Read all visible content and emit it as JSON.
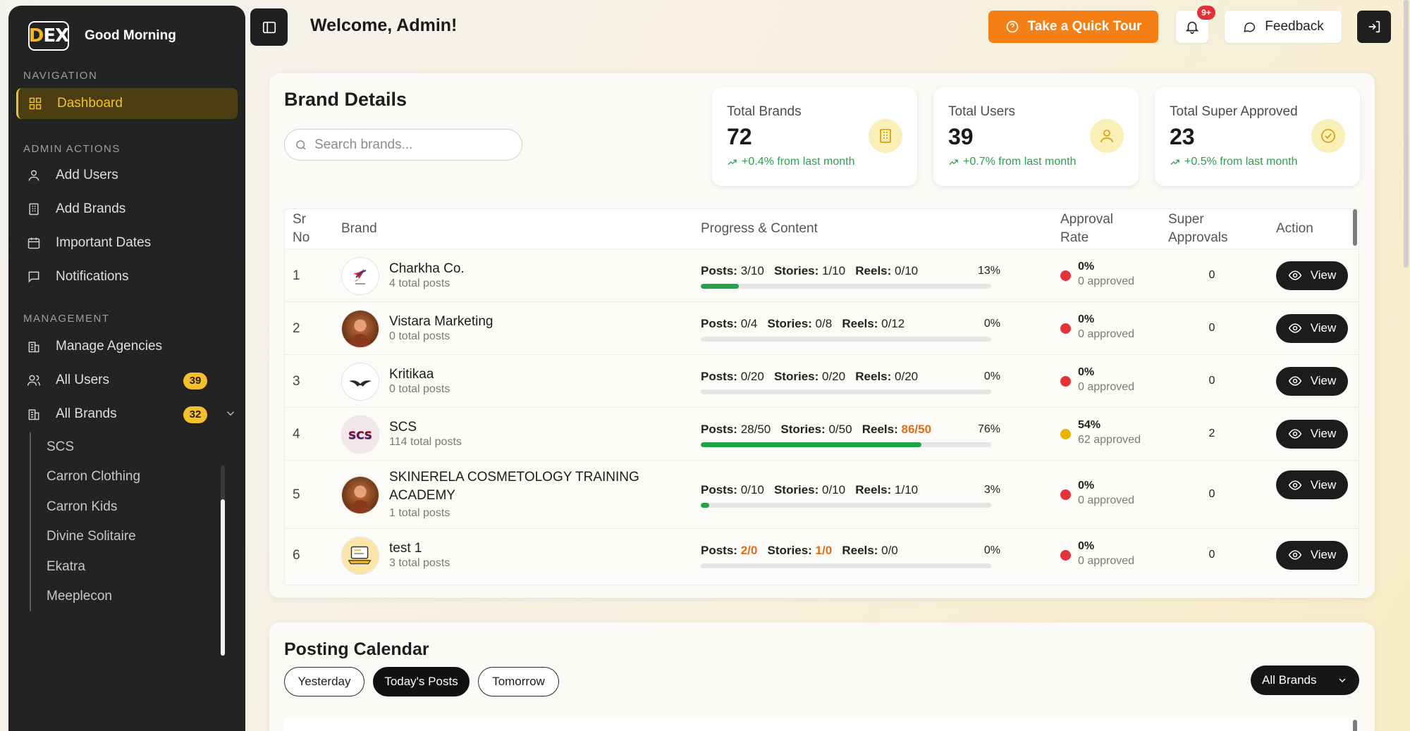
{
  "sidebar": {
    "logo_text_accent": "D",
    "logo_text": "EX",
    "greeting": "Good Morning",
    "sections": {
      "navigation": "NAVIGATION",
      "admin_actions": "ADMIN ACTIONS",
      "management": "MANAGEMENT"
    },
    "nav": {
      "dashboard": "Dashboard",
      "add_users": "Add Users",
      "add_brands": "Add Brands",
      "important_dates": "Important Dates",
      "notifications": "Notifications",
      "manage_agencies": "Manage Agencies",
      "all_users": "All Users",
      "all_users_count": "39",
      "all_brands": "All Brands",
      "all_brands_count": "32"
    },
    "brand_subitems": [
      "SCS",
      "Carron Clothing",
      "Carron Kids",
      "Divine Solitaire",
      "Ekatra",
      "Meeplecon"
    ]
  },
  "header": {
    "welcome": "Welcome, Admin!",
    "tour_label": "Take a Quick Tour",
    "notif_count": "9+",
    "feedback_label": "Feedback"
  },
  "brand_details": {
    "title": "Brand Details",
    "search_placeholder": "Search brands...",
    "stats": [
      {
        "label": "Total Brands",
        "value": "72",
        "delta": "+0.4% from last month",
        "icon": "building-icon"
      },
      {
        "label": "Total Users",
        "value": "39",
        "delta": "+0.7% from last month",
        "icon": "user-icon"
      },
      {
        "label": "Total Super Approved",
        "value": "23",
        "delta": "+0.5% from last month",
        "icon": "check-circle-icon"
      }
    ],
    "columns": {
      "sr_line1": "Sr",
      "sr_line2": "No",
      "brand": "Brand",
      "progress": "Progress & Content",
      "approval_line1": "Approval",
      "approval_line2": "Rate",
      "super_line1": "Super",
      "super_line2": "Approvals",
      "action": "Action"
    },
    "labels": {
      "posts": "Posts:",
      "stories": "Stories:",
      "reels": "Reels:",
      "view": "View"
    },
    "rows": [
      {
        "sr": "1",
        "name_line1": "Charkha Co.",
        "name_line2": "",
        "total": "4 total posts",
        "posts": "3/10",
        "stories": "1/10",
        "reels": "0/10",
        "posts_over": false,
        "stories_over": false,
        "reels_over": false,
        "percent": "13%",
        "progress": 0.13,
        "approval_pct": "0%",
        "approved": "0 approved",
        "status_color": "#e5333b",
        "super": "0",
        "avatar": "bird-logo"
      },
      {
        "sr": "2",
        "name_line1": "Vistara Marketing",
        "name_line2": "",
        "total": "0 total posts",
        "posts": "0/4",
        "stories": "0/8",
        "reels": "0/12",
        "posts_over": false,
        "stories_over": false,
        "reels_over": false,
        "percent": "0%",
        "progress": 0,
        "approval_pct": "0%",
        "approved": "0 approved",
        "status_color": "#e5333b",
        "super": "0",
        "avatar": "photo"
      },
      {
        "sr": "3",
        "name_line1": "Kritikaa",
        "name_line2": "",
        "total": "0 total posts",
        "posts": "0/20",
        "stories": "0/20",
        "reels": "0/20",
        "posts_over": false,
        "stories_over": false,
        "reels_over": false,
        "percent": "0%",
        "progress": 0,
        "approval_pct": "0%",
        "approved": "0 approved",
        "status_color": "#e5333b",
        "super": "0",
        "avatar": "wing-logo"
      },
      {
        "sr": "4",
        "name_line1": "SCS",
        "name_line2": "",
        "total": "114 total posts",
        "posts": "28/50",
        "stories": "0/50",
        "reels": "86/50",
        "posts_over": false,
        "stories_over": false,
        "reels_over": true,
        "percent": "76%",
        "progress": 0.76,
        "approval_pct": "54%",
        "approved": "62 approved",
        "status_color": "#eab308",
        "super": "2",
        "avatar": "scs-logo"
      },
      {
        "sr": "5",
        "name_line1": "SKINERELA COSMETOLOGY TRAINING",
        "name_line2": "ACADEMY",
        "total": "1 total posts",
        "posts": "0/10",
        "stories": "0/10",
        "reels": "1/10",
        "posts_over": false,
        "stories_over": false,
        "reels_over": false,
        "percent": "3%",
        "progress": 0.03,
        "approval_pct": "0%",
        "approved": "0 approved",
        "status_color": "#e5333b",
        "super": "0",
        "avatar": "photo"
      },
      {
        "sr": "6",
        "name_line1": "test 1",
        "name_line2": "",
        "total": "3 total posts",
        "posts": "2/0",
        "stories": "1/0",
        "reels": "0/0",
        "posts_over": true,
        "stories_over": true,
        "reels_over": false,
        "percent": "0%",
        "progress": 0,
        "approval_pct": "0%",
        "approved": "0 approved",
        "status_color": "#e5333b",
        "super": "0",
        "avatar": "laptop-illustration"
      }
    ]
  },
  "posting_calendar": {
    "title": "Posting Calendar",
    "tabs": [
      "Yesterday",
      "Today's Posts",
      "Tomorrow"
    ],
    "active_tab": "Today's Posts",
    "brand_filter": "All Brands"
  },
  "colors": {
    "accent": "#f3bf2d",
    "tour": "#f47f14",
    "sidebar": "#232323",
    "progress": "#21a34a",
    "overflow_text": "#e06d14"
  }
}
